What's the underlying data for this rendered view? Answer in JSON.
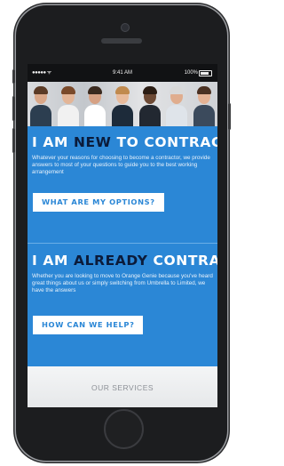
{
  "status_bar": {
    "signal": "●●●●● ᯤ",
    "time": "9:41 AM",
    "battery": "100%"
  },
  "photo_strip": {
    "people": [
      {
        "skin": "#d9a788",
        "hair": "#5b3b26",
        "shirt": "#2c3e50"
      },
      {
        "skin": "#e3b597",
        "hair": "#7a4a2a",
        "shirt": "#f1f1f1"
      },
      {
        "skin": "#d6a184",
        "hair": "#3a2a1f",
        "shirt": "#ffffff"
      },
      {
        "skin": "#e8bb9c",
        "hair": "#c08a4e",
        "shirt": "#1d2b3a"
      },
      {
        "skin": "#6d4a35",
        "hair": "#2b1d14",
        "shirt": "#222831"
      },
      {
        "skin": "#e0ad8e",
        "hair": "#d9d9d9",
        "shirt": "#dfe4ea"
      },
      {
        "skin": "#e4b294",
        "hair": "#4a3122",
        "shirt": "#3b4a5c"
      }
    ]
  },
  "section_new": {
    "heading_pre": "I AM ",
    "heading_highlight": "NEW",
    "heading_post": " TO CONTRACTING",
    "body": "Whatever your reasons for choosing to become a contractor, we provide answers to most of your questions to guide you to the best working arrangement",
    "button": "WHAT ARE MY OPTIONS?"
  },
  "section_already": {
    "heading_pre": "I AM ",
    "heading_highlight": "ALREADY",
    "heading_post": " CONTRACTING",
    "body": "Whether you are looking to move to Orange Genie because you've heard great things about us or simply switching from Umbrella to Limited, we have the answers",
    "button": "HOW CAN WE HELP?"
  },
  "services_label": "OUR SERVICES",
  "colors": {
    "brand_blue": "#2b87d6",
    "highlight_navy": "#0b1b3a"
  }
}
